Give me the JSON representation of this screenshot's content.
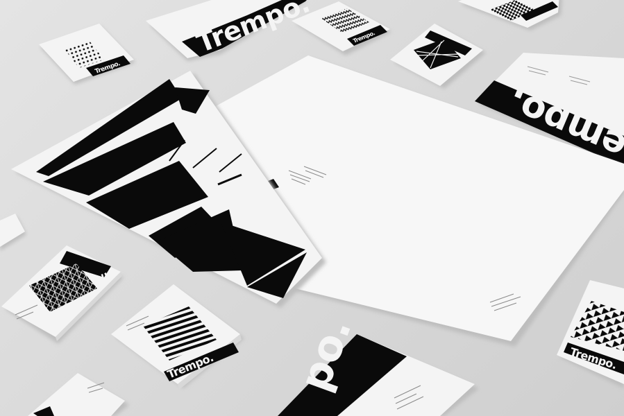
{
  "scene": {
    "description_label": "",
    "brand_name": "Trempo.",
    "brand_fragment_large": "empo.",
    "brand_fragment_bottom": "po.",
    "colors": {
      "background": "#d9d9d9",
      "paper": "#f4f4f4",
      "ink": "#0a0a0a",
      "shadow": "#bdbdbd"
    }
  }
}
